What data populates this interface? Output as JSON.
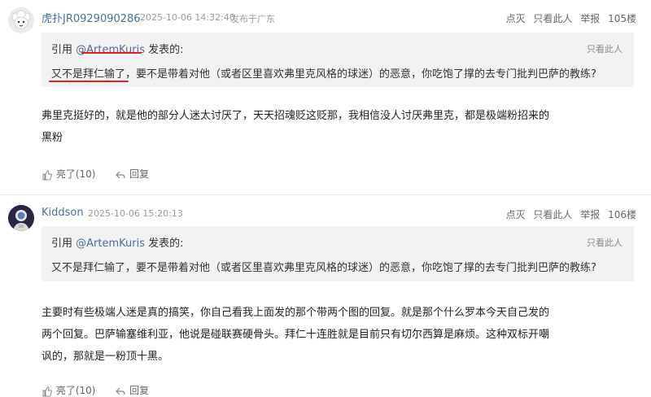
{
  "posts": [
    {
      "username": "虎扑JR0929090286",
      "datetime": "2025-10-06 14:32:40",
      "location": "发布于广东",
      "actions": [
        "点灭",
        "只看此人",
        "举报"
      ],
      "floor": "105楼",
      "quote": {
        "prefix": "引用",
        "mention": "@ArtemKuris",
        "suffix": "发表的:",
        "only_label": "只看此人",
        "text": "又不是拜仁输了，要不是带着对他（或者区里喜欢弗里克风格的球迷）的恶意，你吃饱了撑的去专门批判巴萨的教练?"
      },
      "body_lines": [
        "弗里克挺好的，就是他的部分人迷太讨厌了，天天招魂贬这贬那，我相信没人讨厌弗里克，都是极端粉招来的",
        "黑粉"
      ],
      "like_label": "亮了(10)",
      "reply_label": "回复"
    },
    {
      "username": "Kiddson",
      "datetime": "2025-10-06 15:20:13",
      "location": "",
      "actions": [
        "点灭",
        "只看此人",
        "举报"
      ],
      "floor": "106楼",
      "quote": {
        "prefix": "引用",
        "mention": "@ArtemKuris",
        "suffix": "发表的:",
        "only_label": "只看此人",
        "text": "又不是拜仁输了，要不是带着对他（或者区里喜欢弗里克风格的球迷）的恶意，你吃饱了撑的去专门批判巴萨的教练?"
      },
      "body_lines": [
        "主要时有些极端人迷是真的搞笑，你自己看我上面发的那个带两个图的回复。就是那个什么罗本今天自己发的",
        "两个回复。巴萨输塞维利亚，他说是碰联赛硬骨头。拜仁十连胜就是目前只有切尔西算是麻烦。这种双标开嘲",
        "讽的，那就是一粉顶十黑。"
      ],
      "like_label": "亮了(10)",
      "reply_label": "回复"
    }
  ],
  "colors": {
    "username": "#4a6e98",
    "quote_bg": "#f2f2f2",
    "annotation": "#e02020"
  },
  "icons": {
    "like": "thumbs-up-icon",
    "reply": "reply-arrow-icon",
    "avatar1": "sheep-avatar",
    "avatar2": "astronaut-avatar"
  }
}
